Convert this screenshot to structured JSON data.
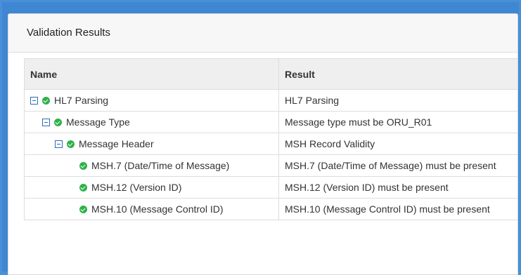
{
  "panel": {
    "title": "Validation Results"
  },
  "table": {
    "headers": {
      "name": "Name",
      "result": "Result"
    },
    "rows": [
      {
        "name": "HL7 Parsing",
        "result": "HL7 Parsing",
        "expandable": true
      },
      {
        "name": "Message Type",
        "result": "Message type must be ORU_R01",
        "expandable": true
      },
      {
        "name": "Message Header",
        "result": "MSH Record Validity",
        "expandable": true
      },
      {
        "name": "MSH.7 (Date/Time of Message)",
        "result": "MSH.7 (Date/Time of Message) must be present",
        "expandable": false
      },
      {
        "name": "MSH.12 (Version ID)",
        "result": "MSH.12 (Version ID) must be present",
        "expandable": false
      },
      {
        "name": "MSH.10 (Message Control ID)",
        "result": "MSH.10 (Message Control ID) must be present",
        "expandable": false
      }
    ]
  },
  "icons": {
    "toggle": "collapse-icon",
    "status": "check-circle-icon"
  },
  "colors": {
    "background": "#4a90d9",
    "success": "#2db24a",
    "toggle": "#2f6bb2"
  }
}
